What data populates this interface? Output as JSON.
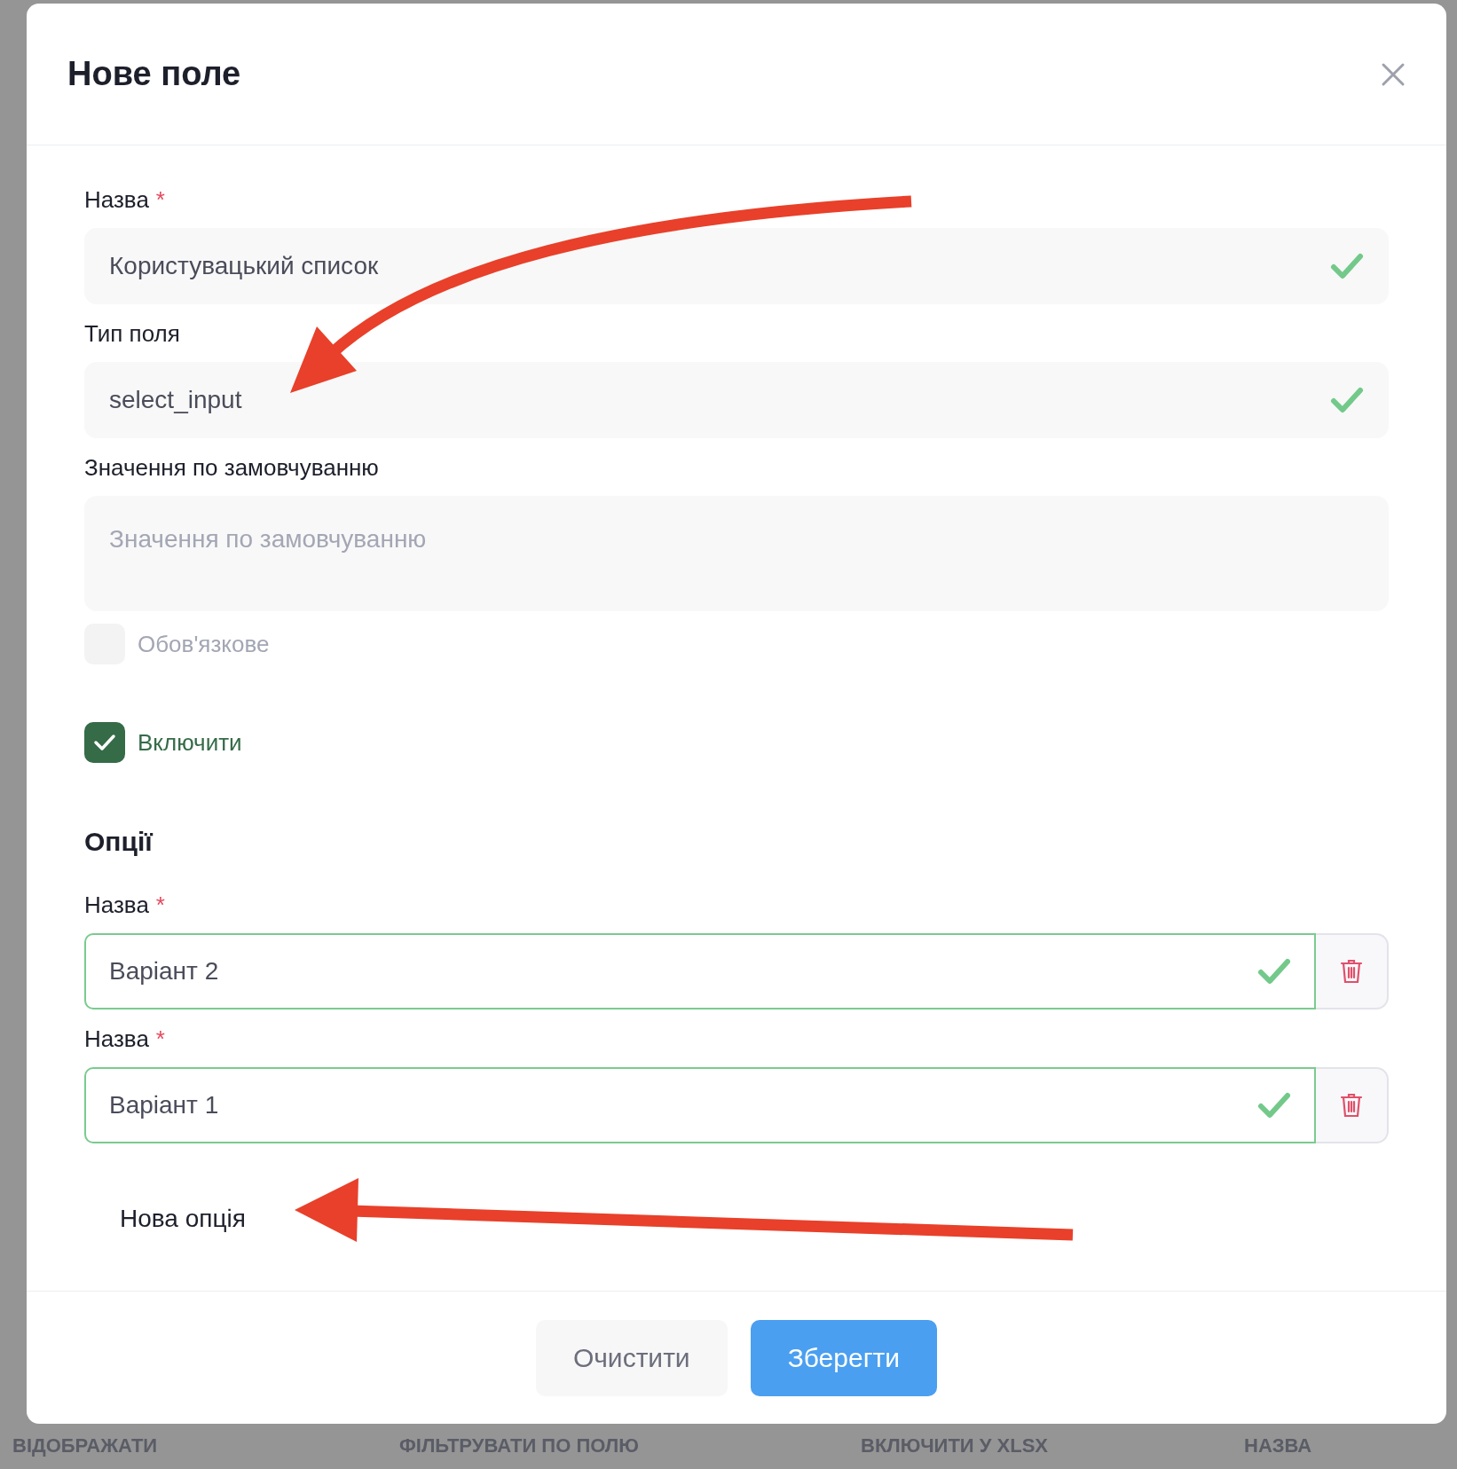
{
  "dialog": {
    "title": "Нове поле",
    "fields": [
      {
        "kind": "input",
        "label": "Назва",
        "required_mark": "*",
        "value": "Користувацький список",
        "valid": true
      },
      {
        "kind": "input",
        "label": "Тип поля",
        "value": "select_input",
        "valid": true
      },
      {
        "kind": "textarea",
        "label": "Значення по замовчуванню",
        "placeholder": "Значення по замовчуванню"
      }
    ],
    "checkboxes": [
      {
        "label": "Обов'язкове",
        "checked": false
      },
      {
        "label": "Включити",
        "checked": true
      }
    ],
    "options_heading": "Опції",
    "options": [
      {
        "label": "Назва",
        "required_mark": "*",
        "value": "Варіант 2",
        "valid": true
      },
      {
        "label": "Назва",
        "required_mark": "*",
        "value": "Варіант 1",
        "valid": true
      }
    ],
    "add_option": "Нова опція",
    "buttons": [
      {
        "kind": "secondary",
        "label": "Очистити"
      },
      {
        "kind": "primary",
        "label": "Зберегти"
      }
    ]
  },
  "background_table": {
    "columns": [
      "ВІДОБРАЖАТИ",
      "ФІЛЬТРУВАТИ ПО ПОЛЮ",
      "ВКЛЮЧИТИ У XLSX",
      "НАЗВА"
    ]
  }
}
